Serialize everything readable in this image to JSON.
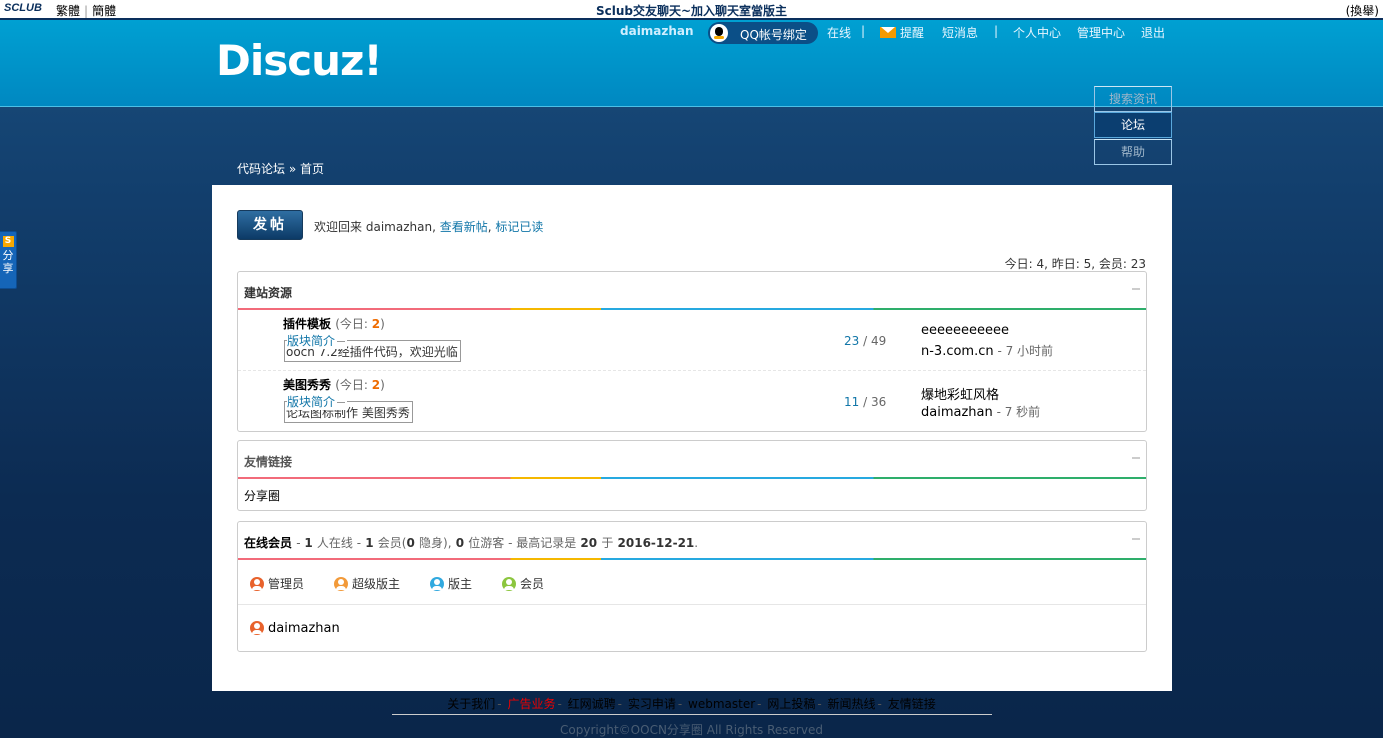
{
  "topbar": {
    "logo": "SCLUB",
    "lang_trad": "繁體",
    "lang_simp": "簡體",
    "title": "Sclub交友聊天~加入聊天室當版主",
    "switch": "(換舉)"
  },
  "header": {
    "brand": "Discuz!",
    "username": "daimazhan",
    "qq_bind": "QQ帐号绑定",
    "online": "在线",
    "notify": "提醒",
    "messages": "短消息",
    "profile": "个人中心",
    "admin": "管理中心",
    "logout": "退出"
  },
  "mainnav": {
    "items": [
      {
        "label": "搜索资讯"
      },
      {
        "label": "论坛"
      },
      {
        "label": "帮助"
      }
    ]
  },
  "breadcrumb": {
    "site": "代码论坛",
    "sep": "»",
    "page": "首页"
  },
  "main": {
    "post_button": "发帖",
    "welcome_prefix": "欢迎回来",
    "welcome_user": "daimazhan",
    "new_posts": "查看新帖",
    "mark_read": "标记已读",
    "stats": "今日: 4, 昨日: 5, 会员: 23"
  },
  "category": {
    "title": "建站资源",
    "forums": [
      {
        "name": "插件模板",
        "today_label": "(今日:",
        "today_count": "2",
        "today_end": ")",
        "desc_label": "版块简介",
        "desc": "oocn 7.2经插件代码，欢迎光临",
        "threads": "23",
        "posts": "49",
        "last_title": "eeeeeeeeeee",
        "last_user": "n-3.com.cn",
        "last_time": "- 7 小时前"
      },
      {
        "name": "美图秀秀",
        "today_label": "(今日:",
        "today_count": "2",
        "today_end": ")",
        "desc_label": "版块简介",
        "desc": "论坛图标制作 美图秀秀",
        "threads": "11",
        "posts": "36",
        "last_title": "爆地彩虹风格",
        "last_user": "daimazhan",
        "last_time": "- 7 秒前"
      }
    ]
  },
  "links_box": {
    "title": "友情链接",
    "item": "分享圈"
  },
  "online_box": {
    "title": "在线会员",
    "online_count": "1",
    "online_label": "人在线 -",
    "member_count": "1",
    "member_label": "会员(",
    "hidden_count": "0",
    "hidden_label": "隐身),",
    "guest_count": "0",
    "guest_label": "位游客 - 最高记录是",
    "record_count": "20",
    "record_on": "于",
    "record_date": "2016-12-21",
    "legend": [
      {
        "label": "管理员",
        "color": "#e8622c"
      },
      {
        "label": "超级版主",
        "color": "#f29a3a"
      },
      {
        "label": "版主",
        "color": "#31a9df"
      },
      {
        "label": "会员",
        "color": "#8cc63f"
      }
    ],
    "user": "daimazhan",
    "user_color": "#e8622c"
  },
  "footer": {
    "links": [
      {
        "label": "关于我们",
        "red": false
      },
      {
        "label": "广告业务",
        "red": true
      },
      {
        "label": "红网诚聘",
        "red": false
      },
      {
        "label": "实习申请",
        "red": false
      },
      {
        "label": "webmaster",
        "red": false
      },
      {
        "label": "网上投稿",
        "red": false
      },
      {
        "label": "新闻热线",
        "red": false
      },
      {
        "label": "友情链接",
        "red": false
      }
    ],
    "copyright": "Copyright©OOCN分享圈 All Rights Reserved"
  },
  "sidebar_share": {
    "icon": "S",
    "label1": "分",
    "label2": "享"
  }
}
